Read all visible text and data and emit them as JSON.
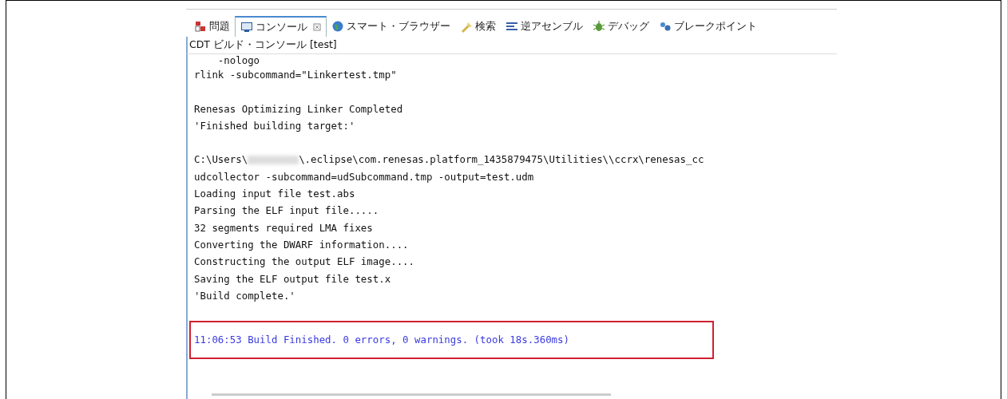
{
  "tabs": [
    {
      "label": "問題",
      "selected": false,
      "closable": false
    },
    {
      "label": "コンソール",
      "selected": true,
      "closable": true
    },
    {
      "label": "スマート・ブラウザー",
      "selected": false,
      "closable": false
    },
    {
      "label": "検索",
      "selected": false,
      "closable": false
    },
    {
      "label": "逆アセンブル",
      "selected": false,
      "closable": false
    },
    {
      "label": "デバッグ",
      "selected": false,
      "closable": false
    },
    {
      "label": "ブレークポイント",
      "selected": false,
      "closable": false
    }
  ],
  "console_title": "CDT ビルド・コンソール [test]",
  "lines": [
    {
      "kind": "partial",
      "text": "    -nologo"
    },
    {
      "kind": "text",
      "text": "rlink -subcommand=\"Linkertest.tmp\""
    },
    {
      "kind": "blank"
    },
    {
      "kind": "text",
      "text": "Renesas Optimizing Linker Completed"
    },
    {
      "kind": "text",
      "text": "'Finished building target:'"
    },
    {
      "kind": "blank"
    },
    {
      "kind": "redacted",
      "before": "C:\\Users\\",
      "after": "\\.eclipse\\com.renesas.platform_1435879475\\Utilities\\\\ccrx\\renesas_cc"
    },
    {
      "kind": "text",
      "text": "udcollector -subcommand=udSubcommand.tmp -output=test.udm"
    },
    {
      "kind": "text",
      "text": "Loading input file test.abs"
    },
    {
      "kind": "text",
      "text": "Parsing the ELF input file....."
    },
    {
      "kind": "text",
      "text": "32 segments required LMA fixes"
    },
    {
      "kind": "text",
      "text": "Converting the DWARF information...."
    },
    {
      "kind": "text",
      "text": "Constructing the output ELF image...."
    },
    {
      "kind": "text",
      "text": "Saving the ELF output file test.x"
    },
    {
      "kind": "text",
      "text": "'Build complete.'"
    },
    {
      "kind": "blank"
    },
    {
      "kind": "highlight",
      "text": "11:06:53 Build Finished. 0 errors, 0 warnings. (took 18s.360ms)"
    }
  ]
}
